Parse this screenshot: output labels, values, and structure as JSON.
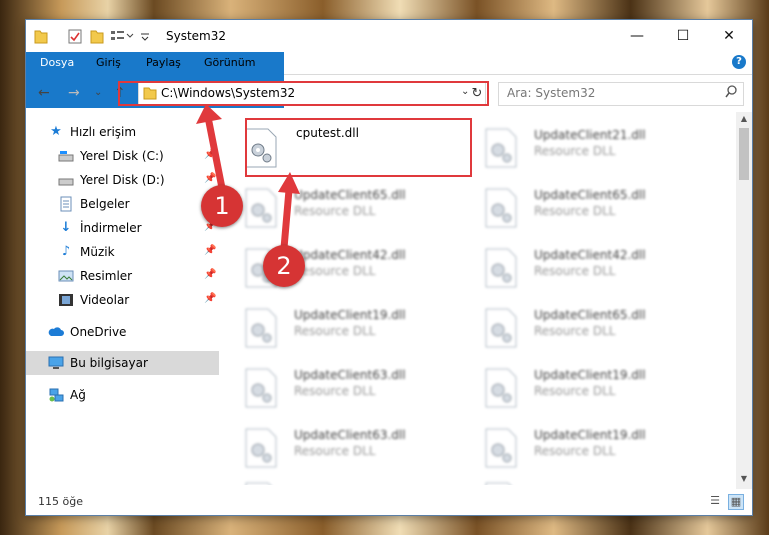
{
  "window": {
    "title": "System32",
    "controls": {
      "minimize": "—",
      "maximize": "☐",
      "close": "✕"
    }
  },
  "ribbon": {
    "tabs": [
      "Dosya",
      "Giriş",
      "Paylaş",
      "Görünüm"
    ],
    "help": "?"
  },
  "address_bar": {
    "path": "C:\\Windows\\System32",
    "dropdown": "⌄",
    "refresh": "↻"
  },
  "search": {
    "placeholder": "Ara: System32",
    "icon": "search-icon"
  },
  "nav_buttons": {
    "back": "←",
    "forward": "→",
    "recent": "⌄",
    "up": "↑"
  },
  "sidebar": {
    "items": [
      {
        "label": "Hızlı erişim",
        "icon": "star-icon",
        "pinned": false
      },
      {
        "label": "Yerel Disk (C:)",
        "icon": "drive-icon",
        "pinned": true
      },
      {
        "label": "Yerel Disk (D:)",
        "icon": "drive-icon",
        "pinned": true
      },
      {
        "label": "Belgeler",
        "icon": "documents-icon",
        "pinned": true
      },
      {
        "label": "İndirmeler",
        "icon": "download-icon",
        "pinned": true
      },
      {
        "label": "Müzik",
        "icon": "music-icon",
        "pinned": true
      },
      {
        "label": "Resimler",
        "icon": "pictures-icon",
        "pinned": true
      },
      {
        "label": "Videolar",
        "icon": "video-icon",
        "pinned": true
      },
      {
        "label": "OneDrive",
        "icon": "cloud-icon",
        "pinned": false
      },
      {
        "label": "Bu bilgisayar",
        "icon": "computer-icon",
        "pinned": false,
        "selected": true
      },
      {
        "label": "Ağ",
        "icon": "network-icon",
        "pinned": false
      }
    ]
  },
  "files": [
    {
      "name": "cputest.dll",
      "type": ""
    },
    {
      "name": "UpdateClient21.dll",
      "type": "Resource DLL"
    },
    {
      "name": "UpdateClient65.dll",
      "type": "Resource DLL"
    },
    {
      "name": "UpdateClient65.dll",
      "type": "Resource DLL"
    },
    {
      "name": "UpdateClient42.dll",
      "type": "Resource DLL"
    },
    {
      "name": "UpdateClient42.dll",
      "type": "Resource DLL"
    },
    {
      "name": "UpdateClient19.dll",
      "type": "Resource DLL"
    },
    {
      "name": "UpdateClient65.dll",
      "type": "Resource DLL"
    },
    {
      "name": "UpdateClient63.dll",
      "type": "Resource DLL"
    },
    {
      "name": "UpdateClient19.dll",
      "type": "Resource DLL"
    },
    {
      "name": "UpdateClient63.dll",
      "type": "Resource DLL"
    },
    {
      "name": "UpdateClient19.dll",
      "type": "Resource DLL"
    },
    {
      "name": "",
      "type": ""
    },
    {
      "name": "",
      "type": ""
    }
  ],
  "status": {
    "item_count": "115 öğe"
  },
  "annotations": {
    "marker1": "1",
    "marker2": "2"
  },
  "colors": {
    "accent": "#1979ca",
    "highlight": "#e0393c"
  }
}
